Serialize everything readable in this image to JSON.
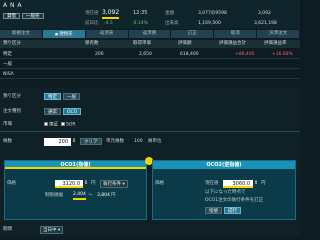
{
  "header": {
    "stock_name": "A N A",
    "tags": [
      "貸借",
      "一般売"
    ],
    "current_price_label": "現在値",
    "current_price": "3,092",
    "time": "12:35",
    "prev_close_label": "前日比",
    "change_value": "-4.5",
    "change_pct": "-0.14%",
    "stat_labels": [
      "金額",
      "出来高"
    ],
    "stat_values": [
      "3,077の9598",
      "1,169,500"
    ],
    "stat_values2": [
      "3,092",
      "3,621,198"
    ]
  },
  "tabs": [
    "新規注文",
    "現物売",
    "返済売",
    "返済買",
    "訂正",
    "取消",
    "決済注文"
  ],
  "holdings": {
    "columns": [
      "預り区分",
      "保有数",
      "取得単価",
      "評価額",
      "評価損益合計",
      "評価損益率"
    ],
    "rows": [
      {
        "cells": [
          "特定",
          "200",
          "2,650",
          "618,400",
          "+88,400",
          "+16.68%"
        ]
      },
      {
        "cells": [
          "一般",
          "",
          "",
          "",
          "",
          ""
        ]
      },
      {
        "cells": [
          "NISA",
          "",
          "",
          "",
          "",
          ""
        ]
      }
    ]
  },
  "order": {
    "account_label": "預り区分",
    "account_options": [
      "特定",
      "一般"
    ],
    "order_type_label": "注文種別",
    "order_type_options": [
      "通常",
      "OCO"
    ],
    "market_label": "市場",
    "market_options": [
      "東証",
      "SOR"
    ],
    "qty_label": "株数",
    "qty_value": "200",
    "clear_label": "クリア",
    "unit_label": "単元株数",
    "unit_value": "100",
    "unit_suffix": "株単位"
  },
  "oco1": {
    "title": "OCO1(指値)",
    "price_label": "価格",
    "price_value": "3120.0",
    "yen": "円",
    "cond_label": "執行条件",
    "limit_label": "制限値幅",
    "limit_low": "2,404",
    "limit_sep": "～",
    "limit_high": "3,804",
    "limit_unit": "円"
  },
  "oco2": {
    "title": "OCO2(逆指値)",
    "price_label": "価格",
    "trigger_label": "現在値",
    "trigger_value": "3060.0",
    "yen": "円",
    "note1": "以下になった時点で",
    "note2": "OCO1注文の執行条件を訂正",
    "exec_options": [
      "指値",
      "成行"
    ]
  },
  "bottom": {
    "period_label": "期間",
    "period_value": "当日中"
  }
}
